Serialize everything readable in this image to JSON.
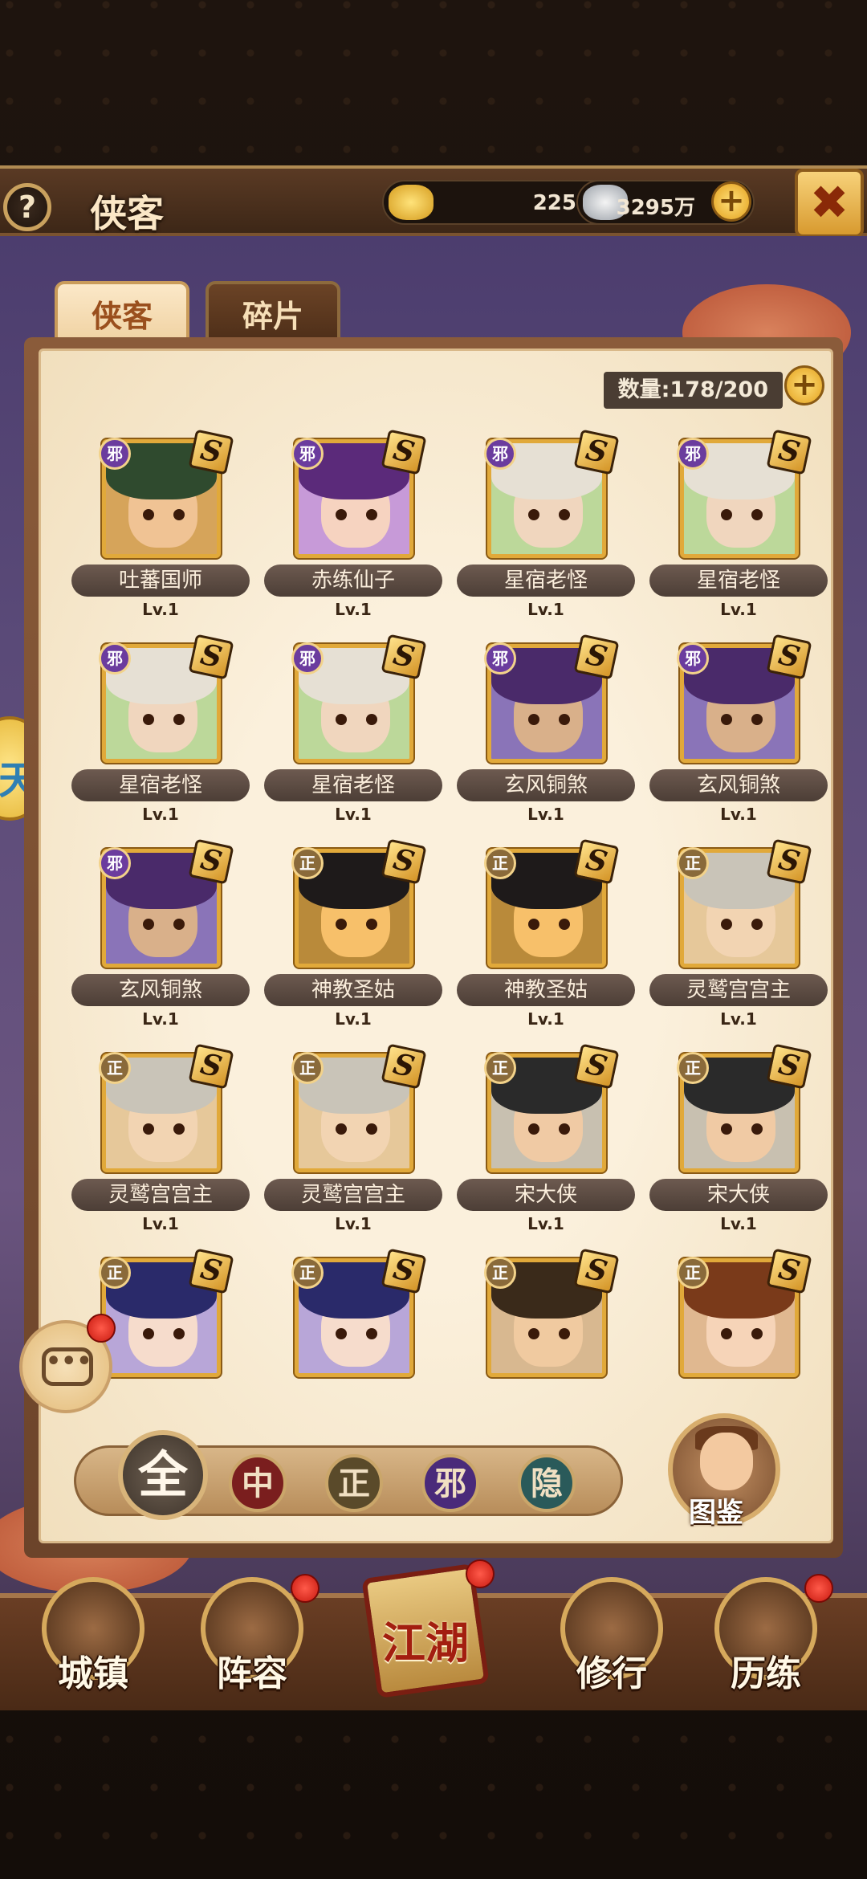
{
  "header": {
    "help_label": "?",
    "title": "侠客",
    "gold": {
      "value": "225",
      "icon": "gold-ingot-icon"
    },
    "silver": {
      "value": "3295万",
      "icon": "silver-ingot-icon"
    },
    "plus": "+",
    "close_icon": "crossed-swords-icon",
    "close_label": "✖"
  },
  "tabs": [
    {
      "label": "侠客",
      "active": true
    },
    {
      "label": "碎片",
      "active": false
    }
  ],
  "count": {
    "label": "数量:178/200"
  },
  "faction_colors": {
    "邪": "#6b3c9e",
    "正": "#8a6a3a"
  },
  "heroes": [
    {
      "name": "吐蕃国师",
      "level": "Lv.1",
      "faction": "邪",
      "rarity": "S",
      "hair": "#2f4a2e",
      "skin": "#f0c394",
      "bg": "#d6a45a"
    },
    {
      "name": "赤练仙子",
      "level": "Lv.1",
      "faction": "邪",
      "rarity": "S",
      "hair": "#5b2a7a",
      "skin": "#f6d3c0",
      "bg": "#c79ad8"
    },
    {
      "name": "星宿老怪",
      "level": "Lv.1",
      "faction": "邪",
      "rarity": "S",
      "hair": "#e6e0d4",
      "skin": "#f0d6be",
      "bg": "#bcd89a"
    },
    {
      "name": "星宿老怪",
      "level": "Lv.1",
      "faction": "邪",
      "rarity": "S",
      "hair": "#e6e0d4",
      "skin": "#f0d6be",
      "bg": "#bcd89a"
    },
    {
      "name": "星宿老怪",
      "level": "Lv.1",
      "faction": "邪",
      "rarity": "S",
      "hair": "#e6e0d4",
      "skin": "#f0d6be",
      "bg": "#bcd89a"
    },
    {
      "name": "星宿老怪",
      "level": "Lv.1",
      "faction": "邪",
      "rarity": "S",
      "hair": "#e6e0d4",
      "skin": "#f0d6be",
      "bg": "#bcd89a"
    },
    {
      "name": "玄风铜煞",
      "level": "Lv.1",
      "faction": "邪",
      "rarity": "S",
      "hair": "#4a2a6a",
      "skin": "#d9b08a",
      "bg": "#8a74b8"
    },
    {
      "name": "玄风铜煞",
      "level": "Lv.1",
      "faction": "邪",
      "rarity": "S",
      "hair": "#4a2a6a",
      "skin": "#d9b08a",
      "bg": "#8a74b8"
    },
    {
      "name": "玄风铜煞",
      "level": "Lv.1",
      "faction": "邪",
      "rarity": "S",
      "hair": "#4a2a6a",
      "skin": "#d9b08a",
      "bg": "#8a74b8"
    },
    {
      "name": "神教圣姑",
      "level": "Lv.1",
      "faction": "正",
      "rarity": "S",
      "hair": "#1e1a1a",
      "skin": "#f7c06a",
      "bg": "#b98a3a"
    },
    {
      "name": "神教圣姑",
      "level": "Lv.1",
      "faction": "正",
      "rarity": "S",
      "hair": "#1e1a1a",
      "skin": "#f7c06a",
      "bg": "#b98a3a"
    },
    {
      "name": "灵鹫宫宫主",
      "level": "Lv.1",
      "faction": "正",
      "rarity": "S",
      "hair": "#c9c4b8",
      "skin": "#f2d4b2",
      "bg": "#e6c89a"
    },
    {
      "name": "灵鹫宫宫主",
      "level": "Lv.1",
      "faction": "正",
      "rarity": "S",
      "hair": "#c9c4b8",
      "skin": "#f2d4b2",
      "bg": "#e6c89a"
    },
    {
      "name": "灵鹫宫宫主",
      "level": "Lv.1",
      "faction": "正",
      "rarity": "S",
      "hair": "#c9c4b8",
      "skin": "#f2d4b2",
      "bg": "#e6c89a"
    },
    {
      "name": "宋大侠",
      "level": "Lv.1",
      "faction": "正",
      "rarity": "S",
      "hair": "#2a2a2a",
      "skin": "#f0caa4",
      "bg": "#c8c0b0"
    },
    {
      "name": "宋大侠",
      "level": "Lv.1",
      "faction": "正",
      "rarity": "S",
      "hair": "#2a2a2a",
      "skin": "#f0caa4",
      "bg": "#c8c0b0"
    },
    {
      "name": "",
      "level": "",
      "faction": "正",
      "rarity": "S",
      "hair": "#2a2a6a",
      "skin": "#f6dccc",
      "bg": "#b8a6d8"
    },
    {
      "name": "",
      "level": "",
      "faction": "正",
      "rarity": "S",
      "hair": "#2a2a6a",
      "skin": "#f6dccc",
      "bg": "#b8a6d8"
    },
    {
      "name": "",
      "level": "",
      "faction": "正",
      "rarity": "S",
      "hair": "#3a2a1a",
      "skin": "#f0caa0",
      "bg": "#d8b890"
    },
    {
      "name": "",
      "level": "",
      "faction": "正",
      "rarity": "S",
      "hair": "#7a3a1a",
      "skin": "#f6d4b8",
      "bg": "#e0b890"
    }
  ],
  "filters": [
    {
      "label": "全",
      "bg": "#4a3d33"
    },
    {
      "label": "中",
      "bg": "#7a1e1e"
    },
    {
      "label": "正",
      "bg": "#5a4a2a"
    },
    {
      "label": "邪",
      "bg": "#4a2a7a"
    },
    {
      "label": "隐",
      "bg": "#2a5a5a"
    }
  ],
  "gallery": {
    "label": "图鉴"
  },
  "side_bubble": {
    "label": "天"
  },
  "chat": {
    "label": "•••"
  },
  "nav": [
    {
      "label": "城镇",
      "icon": "town-icon",
      "badge": false
    },
    {
      "label": "阵容",
      "icon": "lineup-icon",
      "badge": true
    },
    {
      "label": "江湖",
      "icon": "jianghu-scroll-icon",
      "badge": true
    },
    {
      "label": "修行",
      "icon": "cultivation-icon",
      "badge": false
    },
    {
      "label": "历练",
      "icon": "training-icon",
      "badge": true
    }
  ]
}
